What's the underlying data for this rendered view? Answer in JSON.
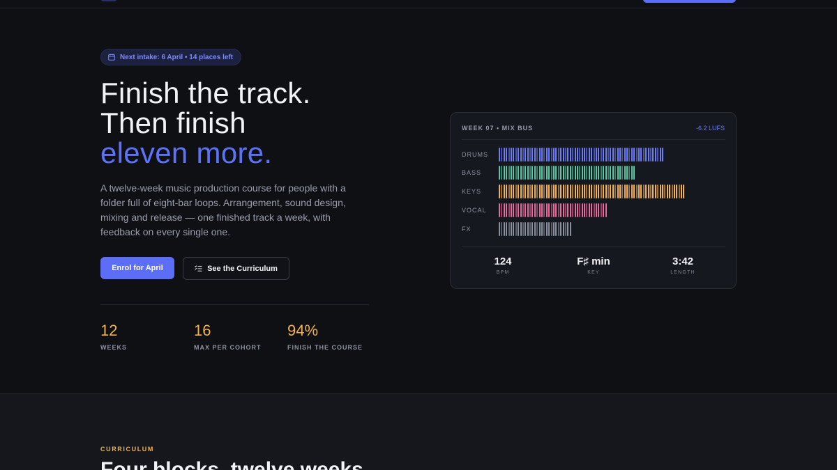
{
  "hero": {
    "badge": "Next intake: 6 April • 14 places left",
    "headline_line1": "Finish the track.",
    "headline_line2": "Then finish",
    "headline_accent": "eleven more.",
    "lede": "A twelve-week music production course for people with a folder full of eight-bar loops. Arrangement, sound design, mixing and release — one finished track a week, with feedback on every single one.",
    "cta_primary": "Enrol for April",
    "cta_secondary": "See the Curriculum"
  },
  "stats": [
    {
      "value": "12",
      "label": "WEEKS"
    },
    {
      "value": "16",
      "label": "MAX PER COHORT"
    },
    {
      "value": "94%",
      "label": "FINISH THE COURSE"
    }
  ],
  "mix_card": {
    "title": "WEEK 07 • MIX BUS",
    "loudness": "-6.2 LUFS",
    "tracks": [
      {
        "name": "DRUMS",
        "color": "#6c7cf5",
        "fill": 0.78
      },
      {
        "name": "BASS",
        "color": "#56c9a3",
        "fill": 0.64
      },
      {
        "name": "KEYS",
        "color": "#f3b24a",
        "fill": 0.88
      },
      {
        "name": "VOCAL",
        "color": "#e8699c",
        "fill": 0.51
      },
      {
        "name": "FX",
        "color": "#8a8f9c",
        "fill": 0.34
      }
    ],
    "meta": [
      {
        "value": "124",
        "label": "BPM"
      },
      {
        "value": "F♯ min",
        "label": "KEY"
      },
      {
        "value": "3:42",
        "label": "LENGTH"
      }
    ]
  },
  "curriculum": {
    "eyebrow": "CURRICULUM",
    "title": "Four blocks, twelve weeks"
  },
  "colors": {
    "background": "#0f1014",
    "accent": "#5b6ef5",
    "highlight": "#f3b24a"
  }
}
